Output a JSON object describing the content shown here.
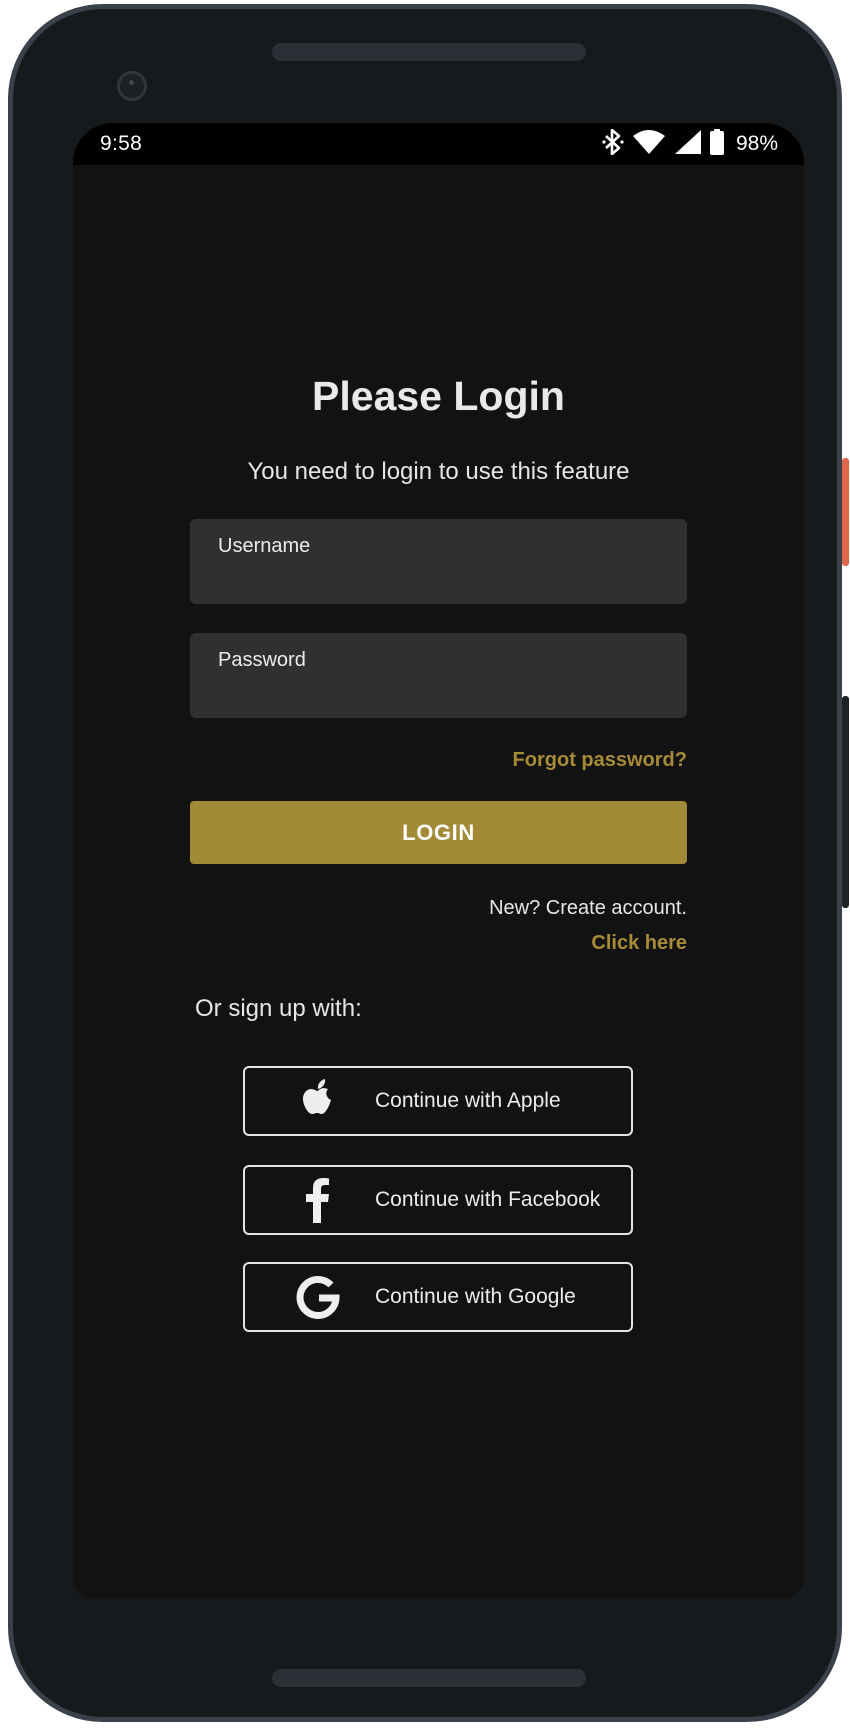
{
  "status_bar": {
    "time": "9:58",
    "battery": "98%",
    "icons": [
      "bluetooth-icon",
      "wifi-icon",
      "cellular-signal-icon",
      "battery-icon"
    ]
  },
  "login": {
    "title": "Please Login",
    "subtitle": "You need to login to use this feature",
    "username_label": "Username",
    "password_label": "Password",
    "forgot_password": "Forgot password?",
    "login_button": "LOGIN",
    "new_account_text": "New? Create account.",
    "click_here": "Click here",
    "signup_label": "Or sign up with:"
  },
  "social": {
    "apple": "Continue with Apple",
    "facebook": "Continue with Facebook",
    "google": "Continue with Google"
  },
  "colors": {
    "background": "#121212",
    "accent": "#a38a36",
    "field": "#303030",
    "text": "#e6e6e6"
  }
}
